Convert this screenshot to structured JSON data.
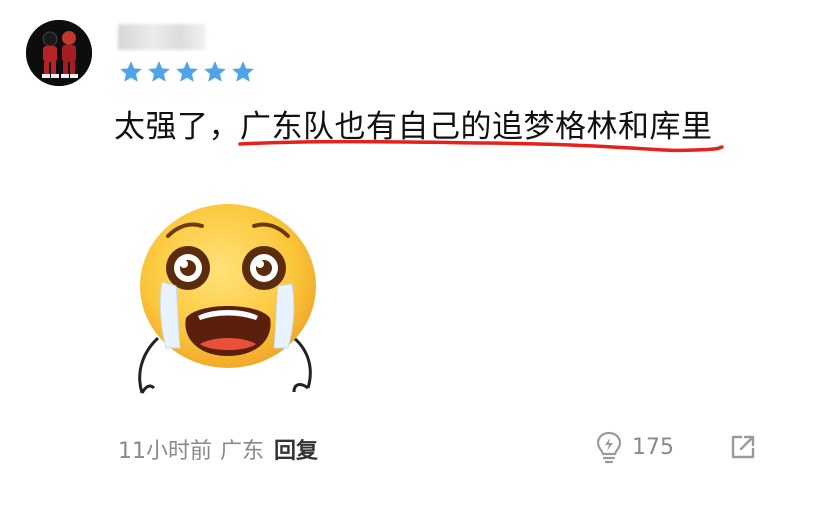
{
  "comment": {
    "username": "",
    "rating": 5,
    "text": "太强了，广东队也有自己的追梦格林和库里",
    "time": "11小时前",
    "location": "广东",
    "reply_label": "回复",
    "like_count": "175"
  },
  "colors": {
    "star": "#4fa3e8",
    "underline": "#e8201c",
    "meta": "#8a8a8a"
  },
  "icons": [
    "avatar-image",
    "star-icon",
    "crying-emoji",
    "lightbulb-like-icon",
    "share-icon"
  ]
}
